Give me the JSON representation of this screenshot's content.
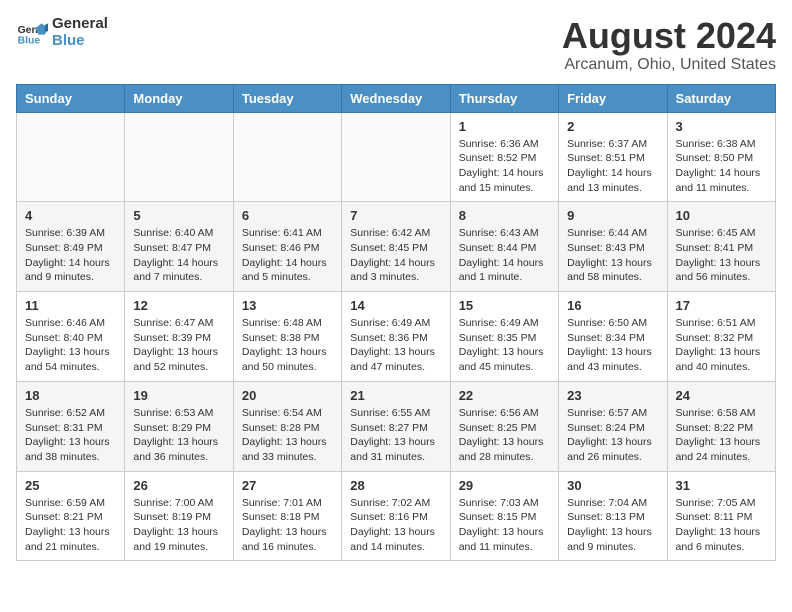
{
  "header": {
    "logo_line1": "General",
    "logo_line2": "Blue",
    "title": "August 2024",
    "subtitle": "Arcanum, Ohio, United States"
  },
  "days_of_week": [
    "Sunday",
    "Monday",
    "Tuesday",
    "Wednesday",
    "Thursday",
    "Friday",
    "Saturday"
  ],
  "weeks": [
    [
      {
        "day": "",
        "content": ""
      },
      {
        "day": "",
        "content": ""
      },
      {
        "day": "",
        "content": ""
      },
      {
        "day": "",
        "content": ""
      },
      {
        "day": "1",
        "content": "Sunrise: 6:36 AM\nSunset: 8:52 PM\nDaylight: 14 hours\nand 15 minutes."
      },
      {
        "day": "2",
        "content": "Sunrise: 6:37 AM\nSunset: 8:51 PM\nDaylight: 14 hours\nand 13 minutes."
      },
      {
        "day": "3",
        "content": "Sunrise: 6:38 AM\nSunset: 8:50 PM\nDaylight: 14 hours\nand 11 minutes."
      }
    ],
    [
      {
        "day": "4",
        "content": "Sunrise: 6:39 AM\nSunset: 8:49 PM\nDaylight: 14 hours\nand 9 minutes."
      },
      {
        "day": "5",
        "content": "Sunrise: 6:40 AM\nSunset: 8:47 PM\nDaylight: 14 hours\nand 7 minutes."
      },
      {
        "day": "6",
        "content": "Sunrise: 6:41 AM\nSunset: 8:46 PM\nDaylight: 14 hours\nand 5 minutes."
      },
      {
        "day": "7",
        "content": "Sunrise: 6:42 AM\nSunset: 8:45 PM\nDaylight: 14 hours\nand 3 minutes."
      },
      {
        "day": "8",
        "content": "Sunrise: 6:43 AM\nSunset: 8:44 PM\nDaylight: 14 hours\nand 1 minute."
      },
      {
        "day": "9",
        "content": "Sunrise: 6:44 AM\nSunset: 8:43 PM\nDaylight: 13 hours\nand 58 minutes."
      },
      {
        "day": "10",
        "content": "Sunrise: 6:45 AM\nSunset: 8:41 PM\nDaylight: 13 hours\nand 56 minutes."
      }
    ],
    [
      {
        "day": "11",
        "content": "Sunrise: 6:46 AM\nSunset: 8:40 PM\nDaylight: 13 hours\nand 54 minutes."
      },
      {
        "day": "12",
        "content": "Sunrise: 6:47 AM\nSunset: 8:39 PM\nDaylight: 13 hours\nand 52 minutes."
      },
      {
        "day": "13",
        "content": "Sunrise: 6:48 AM\nSunset: 8:38 PM\nDaylight: 13 hours\nand 50 minutes."
      },
      {
        "day": "14",
        "content": "Sunrise: 6:49 AM\nSunset: 8:36 PM\nDaylight: 13 hours\nand 47 minutes."
      },
      {
        "day": "15",
        "content": "Sunrise: 6:49 AM\nSunset: 8:35 PM\nDaylight: 13 hours\nand 45 minutes."
      },
      {
        "day": "16",
        "content": "Sunrise: 6:50 AM\nSunset: 8:34 PM\nDaylight: 13 hours\nand 43 minutes."
      },
      {
        "day": "17",
        "content": "Sunrise: 6:51 AM\nSunset: 8:32 PM\nDaylight: 13 hours\nand 40 minutes."
      }
    ],
    [
      {
        "day": "18",
        "content": "Sunrise: 6:52 AM\nSunset: 8:31 PM\nDaylight: 13 hours\nand 38 minutes."
      },
      {
        "day": "19",
        "content": "Sunrise: 6:53 AM\nSunset: 8:29 PM\nDaylight: 13 hours\nand 36 minutes."
      },
      {
        "day": "20",
        "content": "Sunrise: 6:54 AM\nSunset: 8:28 PM\nDaylight: 13 hours\nand 33 minutes."
      },
      {
        "day": "21",
        "content": "Sunrise: 6:55 AM\nSunset: 8:27 PM\nDaylight: 13 hours\nand 31 minutes."
      },
      {
        "day": "22",
        "content": "Sunrise: 6:56 AM\nSunset: 8:25 PM\nDaylight: 13 hours\nand 28 minutes."
      },
      {
        "day": "23",
        "content": "Sunrise: 6:57 AM\nSunset: 8:24 PM\nDaylight: 13 hours\nand 26 minutes."
      },
      {
        "day": "24",
        "content": "Sunrise: 6:58 AM\nSunset: 8:22 PM\nDaylight: 13 hours\nand 24 minutes."
      }
    ],
    [
      {
        "day": "25",
        "content": "Sunrise: 6:59 AM\nSunset: 8:21 PM\nDaylight: 13 hours\nand 21 minutes."
      },
      {
        "day": "26",
        "content": "Sunrise: 7:00 AM\nSunset: 8:19 PM\nDaylight: 13 hours\nand 19 minutes."
      },
      {
        "day": "27",
        "content": "Sunrise: 7:01 AM\nSunset: 8:18 PM\nDaylight: 13 hours\nand 16 minutes."
      },
      {
        "day": "28",
        "content": "Sunrise: 7:02 AM\nSunset: 8:16 PM\nDaylight: 13 hours\nand 14 minutes."
      },
      {
        "day": "29",
        "content": "Sunrise: 7:03 AM\nSunset: 8:15 PM\nDaylight: 13 hours\nand 11 minutes."
      },
      {
        "day": "30",
        "content": "Sunrise: 7:04 AM\nSunset: 8:13 PM\nDaylight: 13 hours\nand 9 minutes."
      },
      {
        "day": "31",
        "content": "Sunrise: 7:05 AM\nSunset: 8:11 PM\nDaylight: 13 hours\nand 6 minutes."
      }
    ]
  ]
}
